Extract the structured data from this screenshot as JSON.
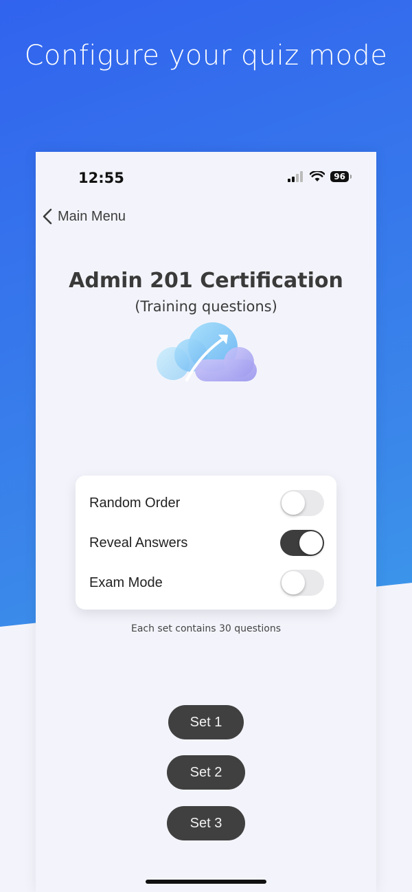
{
  "headline": "Configure your quiz mode",
  "status_bar": {
    "time": "12:55",
    "battery": "96"
  },
  "nav": {
    "back_label": "Main Menu"
  },
  "quiz": {
    "title": "Admin 201 Certification",
    "subtitle": "(Training questions)"
  },
  "settings": [
    {
      "label": "Random Order",
      "on": false
    },
    {
      "label": "Reveal Answers",
      "on": true
    },
    {
      "label": "Exam Mode",
      "on": false
    }
  ],
  "note": "Each set contains 30 questions",
  "sets": [
    {
      "label": "Set 1"
    },
    {
      "label": "Set 2"
    },
    {
      "label": "Set 3"
    }
  ],
  "colors": {
    "gradient_start": "#3163ee",
    "gradient_end": "#3fb0ea",
    "toggle_on": "#3d3d3d",
    "button": "#404040"
  }
}
